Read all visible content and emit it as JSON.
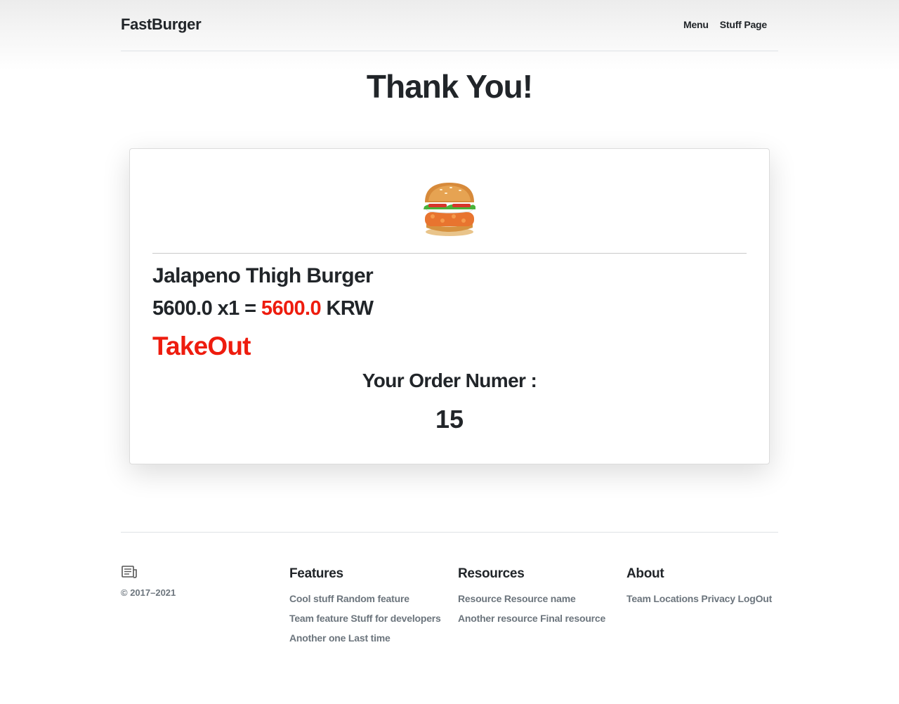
{
  "header": {
    "brand": "FastBurger",
    "nav": [
      "Menu",
      "Stuff Page"
    ]
  },
  "page_title": "Thank You!",
  "order": {
    "item_image": "burger-image",
    "item_name": "Jalapeno Thigh Burger",
    "unit_price": "5600.0",
    "times": "x",
    "quantity": "1",
    "equals": "=",
    "total": "5600.0",
    "currency": "KRW",
    "type": "TakeOut",
    "number_label": "Your Order Numer :",
    "number": "15"
  },
  "footer": {
    "logo_icon": "notebook-icon",
    "copyright": "© 2017–2021",
    "columns": [
      {
        "title": "Features",
        "links": [
          "Cool stuff Random feature",
          "Team feature Stuff for developers",
          "Another one Last time"
        ]
      },
      {
        "title": "Resources",
        "links": [
          "Resource Resource name",
          "Another resource Final resource"
        ]
      },
      {
        "title": "About",
        "links": [
          "Team Locations Privacy LogOut"
        ]
      }
    ]
  },
  "colors": {
    "accent_red": "#ee1c0e",
    "text_dark": "#212529",
    "text_muted": "#6c757d"
  }
}
